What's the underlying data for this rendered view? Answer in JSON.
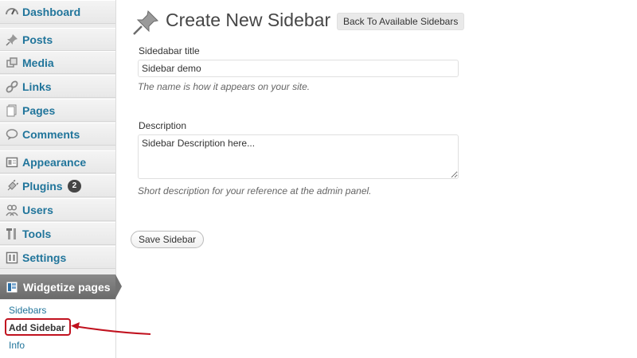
{
  "sidebar": {
    "items": [
      {
        "label": "Dashboard",
        "icon": "dashboard-icon"
      },
      {
        "label": "Posts",
        "icon": "pushpin-icon"
      },
      {
        "label": "Media",
        "icon": "media-icon"
      },
      {
        "label": "Links",
        "icon": "link-icon"
      },
      {
        "label": "Pages",
        "icon": "pages-icon"
      },
      {
        "label": "Comments",
        "icon": "comment-icon"
      },
      {
        "label": "Appearance",
        "icon": "appearance-icon"
      },
      {
        "label": "Plugins",
        "icon": "plugin-icon",
        "badge": "2"
      },
      {
        "label": "Users",
        "icon": "users-icon"
      },
      {
        "label": "Tools",
        "icon": "tools-icon"
      },
      {
        "label": "Settings",
        "icon": "settings-icon"
      }
    ],
    "current": {
      "label": "Widgetize pages",
      "icon": "widgetize-icon"
    },
    "submenu": [
      {
        "label": "Sidebars"
      },
      {
        "label": "Add Sidebar"
      },
      {
        "label": "Info"
      }
    ],
    "colors": {
      "link": "#21759b",
      "highlight": "#c1121f"
    }
  },
  "page": {
    "title": "Create New Sidebar",
    "back_button": "Back To Available Sidebars",
    "title_field": {
      "label": "Sidedabar title",
      "value": "Sidebar demo",
      "hint": "The name is how it appears on your site."
    },
    "description_field": {
      "label": "Description",
      "value": "Sidebar Description here...",
      "hint": "Short description for your reference at the admin panel."
    },
    "save_button": "Save Sidebar"
  }
}
